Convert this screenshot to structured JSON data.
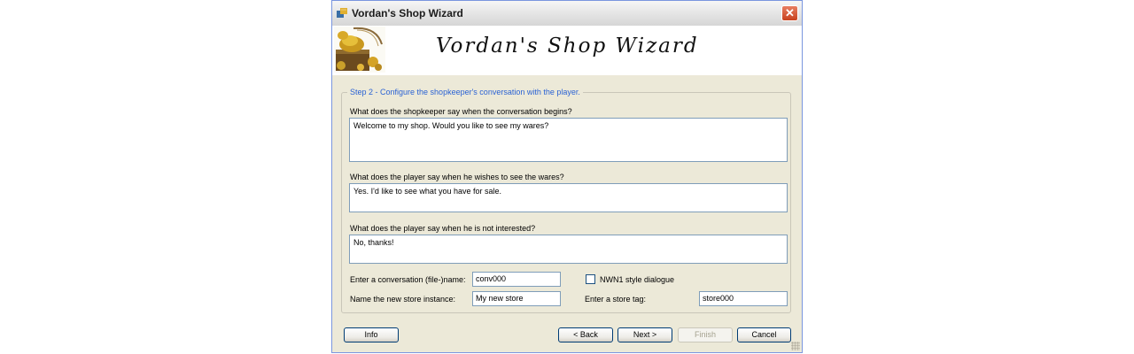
{
  "window": {
    "title": "Vordan's Shop Wizard",
    "close_glyph": "✕"
  },
  "banner": {
    "title": "Vordan's Shop Wizard",
    "art_icon": "treasure-chest-gold-icon"
  },
  "step": {
    "title": "Step 2 - Configure the shopkeeper's conversation with the player."
  },
  "fields": {
    "greeting": {
      "label": "What does the shopkeeper say when the conversation begins?",
      "value": "Welcome to my shop. Would you like to see my wares?"
    },
    "accept": {
      "label": "What does the player say when he wishes to see the wares?",
      "value": "Yes. I'd like to see what you have for sale."
    },
    "decline": {
      "label": "What does the player say when he is not interested?",
      "value": "No, thanks!"
    },
    "conversation_name": {
      "label": "Enter a conversation (file-)name:",
      "value": "conv000"
    },
    "nwn1_style": {
      "label": "NWN1 style dialogue",
      "checked": false
    },
    "store_instance": {
      "label": "Name the new store instance:",
      "value": "My new store"
    },
    "store_tag": {
      "label": "Enter a store tag:",
      "value": "store000"
    }
  },
  "buttons": {
    "info": "Info",
    "back": "< Back",
    "next": "Next >",
    "finish": "Finish",
    "cancel": "Cancel"
  },
  "colors": {
    "legend_text": "#2a62d4",
    "window_bg": "#ece9d8",
    "close_button": "#c8421f"
  }
}
